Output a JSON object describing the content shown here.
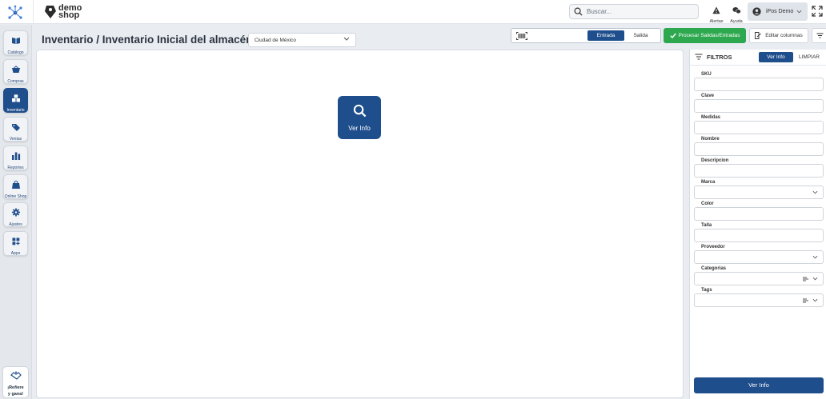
{
  "header": {
    "logo_line1": "demo",
    "logo_line2": "shop",
    "search_placeholder": "Buscar...",
    "alerts_label": "Alertas",
    "help_label": "Ayuda",
    "user_name": "iPos Demo"
  },
  "sidebar": {
    "items": [
      {
        "label": "Catálogo",
        "icon": "book-icon"
      },
      {
        "label": "Compras",
        "icon": "basket-icon"
      },
      {
        "label": "Inventario",
        "icon": "boxes-icon",
        "active": true
      },
      {
        "label": "Ventas",
        "icon": "tag-icon"
      },
      {
        "label": "Reportes",
        "icon": "bar-chart-icon"
      },
      {
        "label": "Online Shop",
        "icon": "shop-bag-icon"
      },
      {
        "label": "Ajustes",
        "icon": "gear-icon"
      },
      {
        "label": "Apps",
        "icon": "apps-grid-icon"
      }
    ],
    "refer_line1": "¡Refiere",
    "refer_line2": "y gana!"
  },
  "toolbar": {
    "page_title": "Inventario / Inventario Inicial del almacén/canal:",
    "store_value": "Ciudad de México",
    "entrada_label": "Entrada",
    "salida_label": "Salida",
    "process_label": "Procesar Salidas/Entradas",
    "edit_columns_label": "Editar columnas"
  },
  "main": {
    "ver_info_label": "Ver Info"
  },
  "filters": {
    "title": "FILTROS",
    "ver_info_label": "Ver Info",
    "clear_label": "LIMPIAR",
    "fields": [
      {
        "label": "SKU",
        "type": "text"
      },
      {
        "label": "Clave",
        "type": "text"
      },
      {
        "label": "Medidas",
        "type": "text"
      },
      {
        "label": "Nombre",
        "type": "text"
      },
      {
        "label": "Descripcion",
        "type": "text"
      },
      {
        "label": "Marca",
        "type": "select"
      },
      {
        "label": "Color",
        "type": "text"
      },
      {
        "label": "Talla",
        "type": "text"
      },
      {
        "label": "Proveedor",
        "type": "select"
      },
      {
        "label": "Categorias",
        "type": "multiselect"
      },
      {
        "label": "Tags",
        "type": "multiselect"
      }
    ],
    "submit_label": "Ver Info"
  },
  "colors": {
    "primary": "#1f4e8c",
    "success": "#2ea84f",
    "background": "#e9edf2"
  }
}
